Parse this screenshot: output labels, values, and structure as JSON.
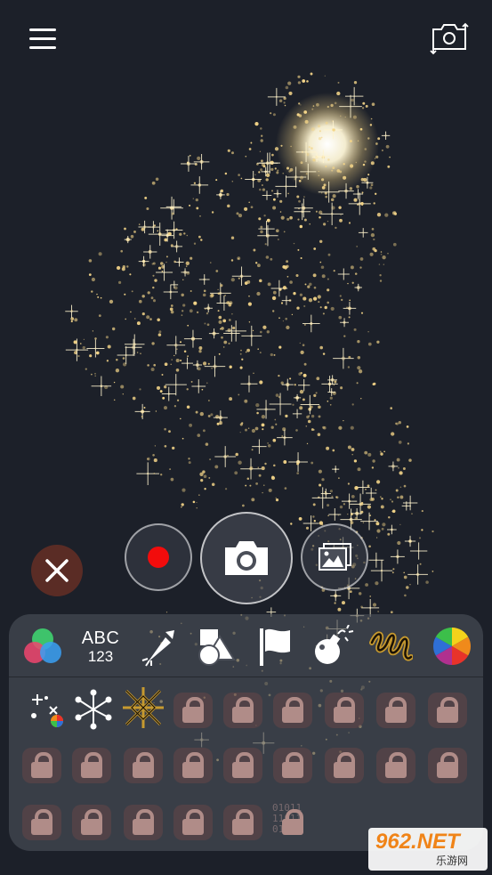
{
  "colors": {
    "background": "#1c2029",
    "sparkle": "#f3d488",
    "record": "#f20c0c",
    "close_bg": "#5a2c25",
    "lock": "#b08c88"
  },
  "top_bar": {
    "menu_icon": "hamburger-menu-icon",
    "switch_camera_icon": "switch-camera-icon"
  },
  "controls": {
    "record_icon": "record-dot-icon",
    "shutter_icon": "camera-icon",
    "gallery_icon": "gallery-icon",
    "close_icon": "close-x-icon"
  },
  "tools": {
    "color_mix_icon": "color-mix-icon",
    "text_top": "ABC",
    "text_bottom": "123",
    "firework_icon": "firework-rocket-icon",
    "shapes_icon": "shapes-icon",
    "flag_icon": "flag-icon",
    "bomb_icon": "bomb-icon",
    "scribble_icon": "scribble-icon",
    "color_wheel_icon": "color-wheel-icon"
  },
  "effects": {
    "binary_text": "01011\n11011\n01100",
    "locked_count": 24
  },
  "watermark": {
    "top": "962.NET",
    "bottom": "乐游网"
  }
}
